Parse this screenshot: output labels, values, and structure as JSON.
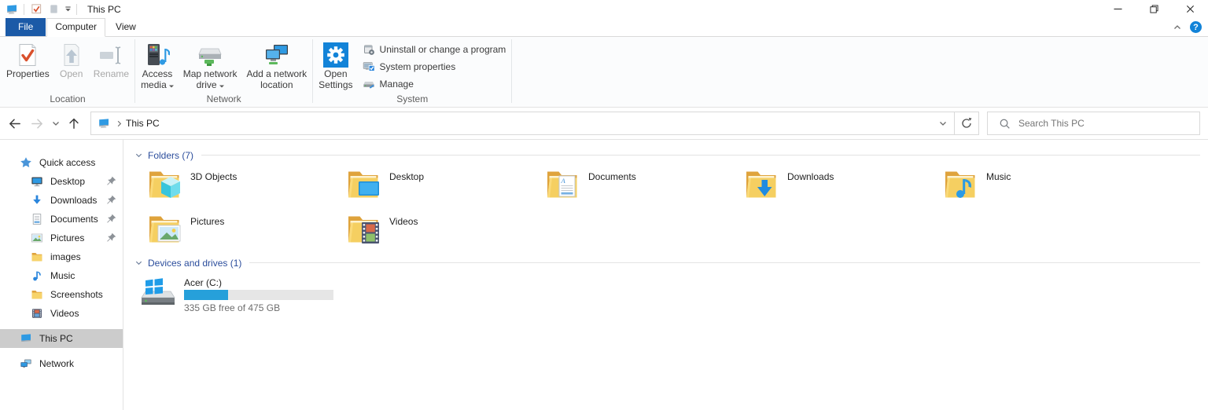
{
  "window": {
    "title": "This PC",
    "qat_icons": [
      {
        "name": "this-pc"
      },
      {
        "name": "qat-checkbox"
      },
      {
        "name": "qat-disabled-item"
      },
      {
        "name": "qat-customize-caret"
      }
    ]
  },
  "tabs": [
    {
      "label": "File",
      "style": "file"
    },
    {
      "label": "Computer",
      "style": "active"
    },
    {
      "label": "View",
      "style": ""
    }
  ],
  "ribbon": {
    "help_label": "?",
    "groups": [
      {
        "label": "Location",
        "buttons": [
          {
            "label_lines": [
              "Properties"
            ],
            "icon": "properties",
            "enabled": true,
            "dropdown": false
          },
          {
            "label_lines": [
              "Open"
            ],
            "icon": "open",
            "enabled": false,
            "dropdown": false
          },
          {
            "label_lines": [
              "Rename"
            ],
            "icon": "rename",
            "enabled": false,
            "dropdown": false
          }
        ]
      },
      {
        "label": "Network",
        "buttons": [
          {
            "label_lines": [
              "Access",
              "media"
            ],
            "icon": "access-media",
            "enabled": true,
            "dropdown": true
          },
          {
            "label_lines": [
              "Map network",
              "drive"
            ],
            "icon": "map-drive",
            "enabled": true,
            "dropdown": true
          },
          {
            "label_lines": [
              "Add a network",
              "location"
            ],
            "icon": "add-network",
            "enabled": true,
            "dropdown": false
          }
        ]
      },
      {
        "label": "System",
        "buttons": [
          {
            "label_lines": [
              "Open",
              "Settings"
            ],
            "icon": "open-settings",
            "enabled": true,
            "dropdown": false
          }
        ],
        "small_buttons": [
          {
            "label": "Uninstall or change a program",
            "icon": "uninstall"
          },
          {
            "label": "System properties",
            "icon": "system-properties"
          },
          {
            "label": "Manage",
            "icon": "manage"
          }
        ]
      }
    ]
  },
  "navbar": {
    "address": {
      "location": "This PC",
      "icon": "this-pc"
    },
    "search": {
      "placeholder": "Search This PC"
    }
  },
  "sidebar": {
    "items": [
      {
        "label": "Quick access",
        "icon": "quick-access-star",
        "level": 0,
        "pinned": false,
        "selected": false,
        "gap": false
      },
      {
        "label": "Desktop",
        "icon": "desktop",
        "level": 1,
        "pinned": true,
        "selected": false,
        "gap": false
      },
      {
        "label": "Downloads",
        "icon": "downloads",
        "level": 1,
        "pinned": true,
        "selected": false,
        "gap": false
      },
      {
        "label": "Documents",
        "icon": "documents",
        "level": 1,
        "pinned": true,
        "selected": false,
        "gap": false
      },
      {
        "label": "Pictures",
        "icon": "pictures",
        "level": 1,
        "pinned": true,
        "selected": false,
        "gap": false
      },
      {
        "label": "images",
        "icon": "folder",
        "level": 1,
        "pinned": false,
        "selected": false,
        "gap": false
      },
      {
        "label": "Music",
        "icon": "music",
        "level": 1,
        "pinned": false,
        "selected": false,
        "gap": false
      },
      {
        "label": "Screenshots",
        "icon": "folder",
        "level": 1,
        "pinned": false,
        "selected": false,
        "gap": false
      },
      {
        "label": "Videos",
        "icon": "videos",
        "level": 1,
        "pinned": false,
        "selected": false,
        "gap": false
      },
      {
        "label": "This PC",
        "icon": "this-pc",
        "level": 0,
        "pinned": false,
        "selected": true,
        "gap": true
      },
      {
        "label": "Network",
        "icon": "network",
        "level": 0,
        "pinned": false,
        "selected": false,
        "gap": true
      }
    ]
  },
  "content": {
    "sections": [
      {
        "title": "Folders (7)",
        "type": "folders",
        "tiles": [
          {
            "name": "3D Objects",
            "icon": "folder-3d"
          },
          {
            "name": "Desktop",
            "icon": "folder-desktop"
          },
          {
            "name": "Documents",
            "icon": "folder-documents"
          },
          {
            "name": "Downloads",
            "icon": "folder-downloads"
          },
          {
            "name": "Music",
            "icon": "folder-music"
          },
          {
            "name": "Pictures",
            "icon": "folder-pictures"
          },
          {
            "name": "Videos",
            "icon": "folder-videos"
          }
        ]
      },
      {
        "title": "Devices and drives (1)",
        "type": "drives",
        "tiles": [
          {
            "name": "Acer (C:)",
            "icon": "drive-windows",
            "free_text": "335 GB free of 475 GB",
            "used_percent": 29.5
          }
        ]
      }
    ]
  },
  "colors": {
    "file_tab": "#1b5aa7",
    "accent_blue": "#2a85dc",
    "capacity_bar_fill": "#26a0da",
    "capacity_bar_bg": "#e6e6e6",
    "section_header_text": "#2b4d9c",
    "sidebar_selected_bg": "#cccccc"
  }
}
